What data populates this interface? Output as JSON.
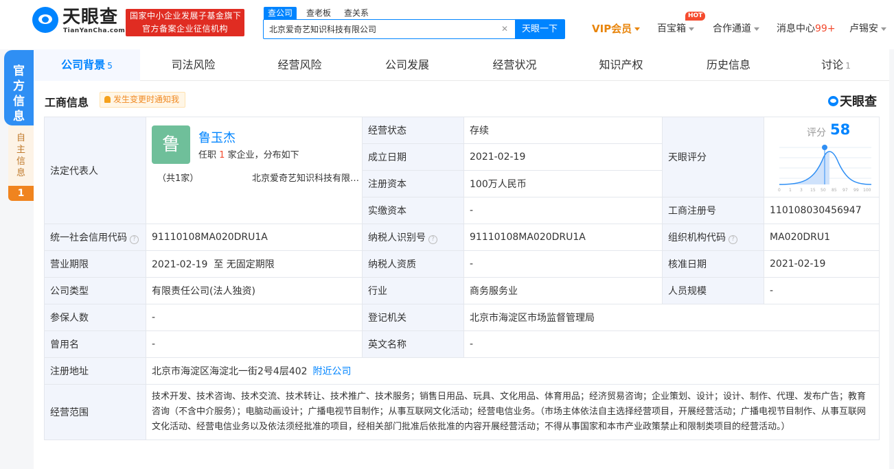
{
  "header": {
    "logo_text": "天眼查",
    "logo_sub": "TianYanCha.com",
    "badge_line1": "国家中小企业发展子基金旗下",
    "badge_line2": "官方备案企业征信机构",
    "search_tabs": [
      "查公司",
      "查老板",
      "查关系"
    ],
    "search_value": "北京爱奇艺知识科技有限公司",
    "search_button": "天眼一下",
    "vip": "VIP会员",
    "toolbox": "百宝箱",
    "hot": "HOT",
    "cooperation": "合作通道",
    "messages": "消息中心",
    "messages_count": "99+",
    "user": "卢锡安"
  },
  "side": {
    "official": "官方信息",
    "self_info": "自主信息",
    "self_count": "1"
  },
  "tabs": [
    {
      "label": "公司背景",
      "count": "5"
    },
    {
      "label": "司法风险",
      "count": ""
    },
    {
      "label": "经营风险",
      "count": ""
    },
    {
      "label": "公司发展",
      "count": ""
    },
    {
      "label": "经营状况",
      "count": ""
    },
    {
      "label": "知识产权",
      "count": ""
    },
    {
      "label": "历史信息",
      "count": ""
    },
    {
      "label": "讨论",
      "count": "1"
    }
  ],
  "section": {
    "title": "工商信息",
    "notify": "发生变更时通知我",
    "brand": "天眼查"
  },
  "legal": {
    "label": "法定代表人",
    "avatar_char": "鲁",
    "name": "鲁玉杰",
    "sub_prefix": "任职",
    "sub_num": "1",
    "sub_suffix": "家企业，分布如下",
    "count": "（共1家）",
    "company": "北京爱奇艺知识科技有限公司"
  },
  "score": {
    "label_cell": "天眼评分",
    "label": "评分",
    "value": "58",
    "ticks": [
      "0",
      "1",
      "3",
      "15",
      "50",
      "85",
      "97",
      "99",
      "100"
    ]
  },
  "fields": {
    "status_label": "经营状态",
    "status": "存续",
    "founded_label": "成立日期",
    "founded": "2021-02-19",
    "capital_label": "注册资本",
    "capital": "100万人民币",
    "paid_label": "实缴资本",
    "paid": "-",
    "regno_label": "工商注册号",
    "regno": "110108030456947",
    "credit_label": "统一社会信用代码",
    "credit": "91110108MA020DRU1A",
    "taxid_label": "纳税人识别号",
    "taxid": "91110108MA020DRU1A",
    "org_label": "组织机构代码",
    "org": "MA020DRU1",
    "term_label": "营业期限",
    "term": "2021-02-19  至 无固定期限",
    "taxq_label": "纳税人资质",
    "taxq": "-",
    "approve_label": "核准日期",
    "approve": "2021-02-19",
    "type_label": "公司类型",
    "type": "有限责任公司(法人独资)",
    "industry_label": "行业",
    "industry": "商务服务业",
    "staff_label": "人员规模",
    "staff": "-",
    "insured_label": "参保人数",
    "insured": "-",
    "authority_label": "登记机关",
    "authority": "北京市海淀区市场监督管理局",
    "former_label": "曾用名",
    "former": "-",
    "english_label": "英文名称",
    "english": "-",
    "address_label": "注册地址",
    "address": "北京市海淀区海淀北一街2号4层402",
    "nearby": "附近公司",
    "scope_label": "经营范围",
    "scope": "技术开发、技术咨询、技术交流、技术转让、技术推广、技术服务；销售日用品、玩具、文化用品、体育用品；经济贸易咨询；企业策划、设计；设计、制作、代理、发布广告；教育咨询（不含中介服务）；电脑动画设计；广播电视节目制作；从事互联网文化活动；经营电信业务。（市场主体依法自主选择经营项目，开展经营活动；广播电视节目制作、从事互联网文化活动、经营电信业务以及依法须经批准的项目，经相关部门批准后依批准的内容开展经营活动；不得从事国家和本市产业政策禁止和限制类项目的经营活动。）"
  }
}
